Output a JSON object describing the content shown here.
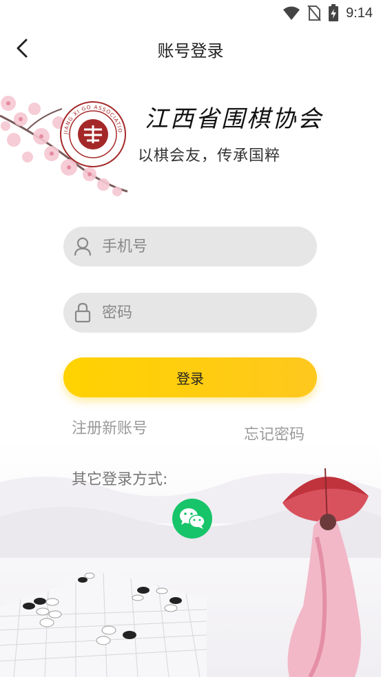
{
  "status_bar": {
    "time": "9:14"
  },
  "nav": {
    "title": "账号登录"
  },
  "org": {
    "title": "江西省围棋协会",
    "slogan": "以棋会友，传承国粹"
  },
  "logo_text": "JIANG XI GO ASSOCIATION",
  "form": {
    "phone_placeholder": "手机号",
    "password_placeholder": "密码",
    "login_label": "登录"
  },
  "links": {
    "register": "注册新账号",
    "forgot": "忘记密码"
  },
  "other_login": {
    "label": "其它登录方式:",
    "wechat_icon": "wechat-icon"
  },
  "colors": {
    "accent": "#ffd200",
    "wechat": "#18c46a",
    "input_bg": "#e6e6e6"
  }
}
